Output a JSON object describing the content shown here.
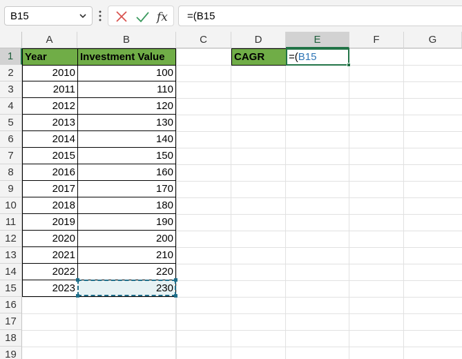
{
  "name_box": {
    "value": "B15"
  },
  "formula_bar": {
    "prefix": "=(",
    "ref": "B15"
  },
  "columns": [
    "A",
    "B",
    "C",
    "D",
    "E",
    "F",
    "G"
  ],
  "rows": [
    "1",
    "2",
    "3",
    "4",
    "5",
    "6",
    "7",
    "8",
    "9",
    "10",
    "11",
    "12",
    "13",
    "14",
    "15",
    "16",
    "17",
    "18",
    "19"
  ],
  "table": {
    "header_year": "Year",
    "header_value": "Investment Value",
    "data": [
      {
        "year": "2010",
        "value": "100"
      },
      {
        "year": "2011",
        "value": "110"
      },
      {
        "year": "2012",
        "value": "120"
      },
      {
        "year": "2013",
        "value": "130"
      },
      {
        "year": "2014",
        "value": "140"
      },
      {
        "year": "2015",
        "value": "150"
      },
      {
        "year": "2016",
        "value": "160"
      },
      {
        "year": "2017",
        "value": "170"
      },
      {
        "year": "2018",
        "value": "180"
      },
      {
        "year": "2019",
        "value": "190"
      },
      {
        "year": "2020",
        "value": "200"
      },
      {
        "year": "2021",
        "value": "210"
      },
      {
        "year": "2022",
        "value": "220"
      },
      {
        "year": "2023",
        "value": "230"
      }
    ]
  },
  "cagr": {
    "label": "CAGR",
    "edit_prefix": "=(",
    "edit_ref": "B15"
  },
  "colors": {
    "header_fill": "#70ad47",
    "active_green": "#217346",
    "ref_blue": "#2e75b6",
    "cancel_red": "#c0392b"
  }
}
